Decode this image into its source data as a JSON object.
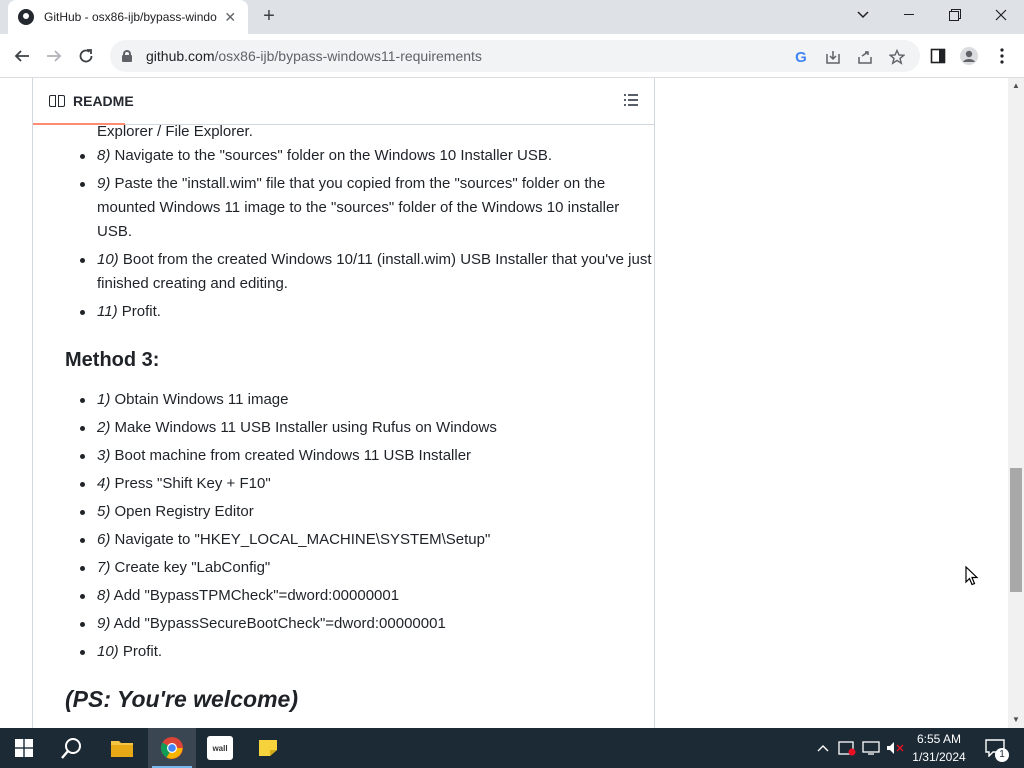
{
  "browser": {
    "tab_title": "GitHub - osx86-ijb/bypass-windo",
    "url_host": "github.com",
    "url_path": "/osx86-ijb/bypass-windows11-requirements"
  },
  "readme": {
    "header": "README"
  },
  "content": {
    "partial_line": "Explorer / File Explorer.",
    "steps_a": [
      {
        "num": "8)",
        "text": " Navigate to the \"sources\" folder on the Windows 10 Installer USB."
      },
      {
        "num": "9)",
        "text": " Paste the \"install.wim\" file that you copied from the \"sources\" folder on the mounted Windows 11 image to the \"sources\" folder of the Windows 10 installer USB."
      },
      {
        "num": "10)",
        "text": " Boot from the created Windows 10/11 (install.wim) USB Installer that you've just finished creating and editing."
      },
      {
        "num": "11)",
        "text": " Profit."
      }
    ],
    "method_heading": "Method 3:",
    "steps_b": [
      {
        "num": "1)",
        "text": " Obtain Windows 11 image"
      },
      {
        "num": "2)",
        "text": " Make Windows 11 USB Installer using Rufus on Windows"
      },
      {
        "num": "3)",
        "text": " Boot machine from created Windows 11 USB Installer"
      },
      {
        "num": "4)",
        "text": " Press \"Shift Key + F10\""
      },
      {
        "num": "5)",
        "text": " Open Registry Editor"
      },
      {
        "num": "6)",
        "text": " Navigate to \"HKEY_LOCAL_MACHINE\\SYSTEM\\Setup\""
      },
      {
        "num": "7)",
        "text": " Create key \"LabConfig\""
      },
      {
        "num": "8)",
        "text": " Add \"BypassTPMCheck\"=dword:00000001"
      },
      {
        "num": "9)",
        "text": " Add \"BypassSecureBootCheck\"=dword:00000001"
      },
      {
        "num": "10)",
        "text": " Profit."
      }
    ],
    "ps": "(PS: You're welcome)"
  },
  "taskbar": {
    "time": "6:55 AM",
    "date": "1/31/2024",
    "notification_count": "1",
    "wallet_label": "wall"
  },
  "colors": {
    "titlebar": "#dee1e6",
    "taskbar": "#1c2a36",
    "tab_underline": "#fd8c73"
  }
}
